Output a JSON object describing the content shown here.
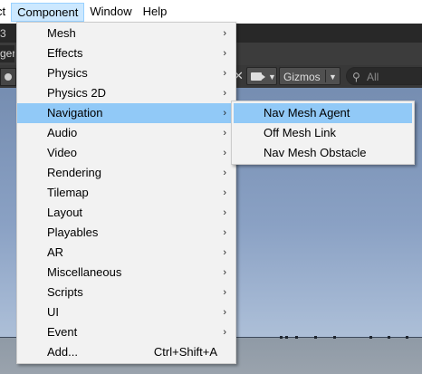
{
  "menubar": {
    "items": [
      {
        "label": "ct"
      },
      {
        "label": "Component"
      },
      {
        "label": "Window"
      },
      {
        "label": "Help"
      }
    ]
  },
  "titlestrip": {
    "left_glyph": "3"
  },
  "toolbar": {
    "left_tab_text": "ger",
    "gizmos_label": "Gizmos",
    "search_placeholder": "All"
  },
  "component_menu": {
    "items": [
      {
        "label": "Mesh",
        "has_submenu": true
      },
      {
        "label": "Effects",
        "has_submenu": true
      },
      {
        "label": "Physics",
        "has_submenu": true
      },
      {
        "label": "Physics 2D",
        "has_submenu": true
      },
      {
        "label": "Navigation",
        "has_submenu": true,
        "highlighted": true
      },
      {
        "label": "Audio",
        "has_submenu": true
      },
      {
        "label": "Video",
        "has_submenu": true
      },
      {
        "label": "Rendering",
        "has_submenu": true
      },
      {
        "label": "Tilemap",
        "has_submenu": true
      },
      {
        "label": "Layout",
        "has_submenu": true
      },
      {
        "label": "Playables",
        "has_submenu": true
      },
      {
        "label": "AR",
        "has_submenu": true
      },
      {
        "label": "Miscellaneous",
        "has_submenu": true
      },
      {
        "label": "Scripts",
        "has_submenu": true
      },
      {
        "label": "UI",
        "has_submenu": true
      },
      {
        "label": "Event",
        "has_submenu": true
      },
      {
        "label": "Add...",
        "shortcut": "Ctrl+Shift+A"
      }
    ],
    "submenu_arrow": "›"
  },
  "navigation_submenu": {
    "items": [
      {
        "label": "Nav Mesh Agent",
        "highlighted": true
      },
      {
        "label": "Off Mesh Link"
      },
      {
        "label": "Nav Mesh Obstacle"
      }
    ]
  },
  "colors": {
    "menu_background": "#f2f2f2",
    "highlight": "#91c9f7",
    "active_menubar": "#cce8ff",
    "unity_dark": "#282828"
  }
}
